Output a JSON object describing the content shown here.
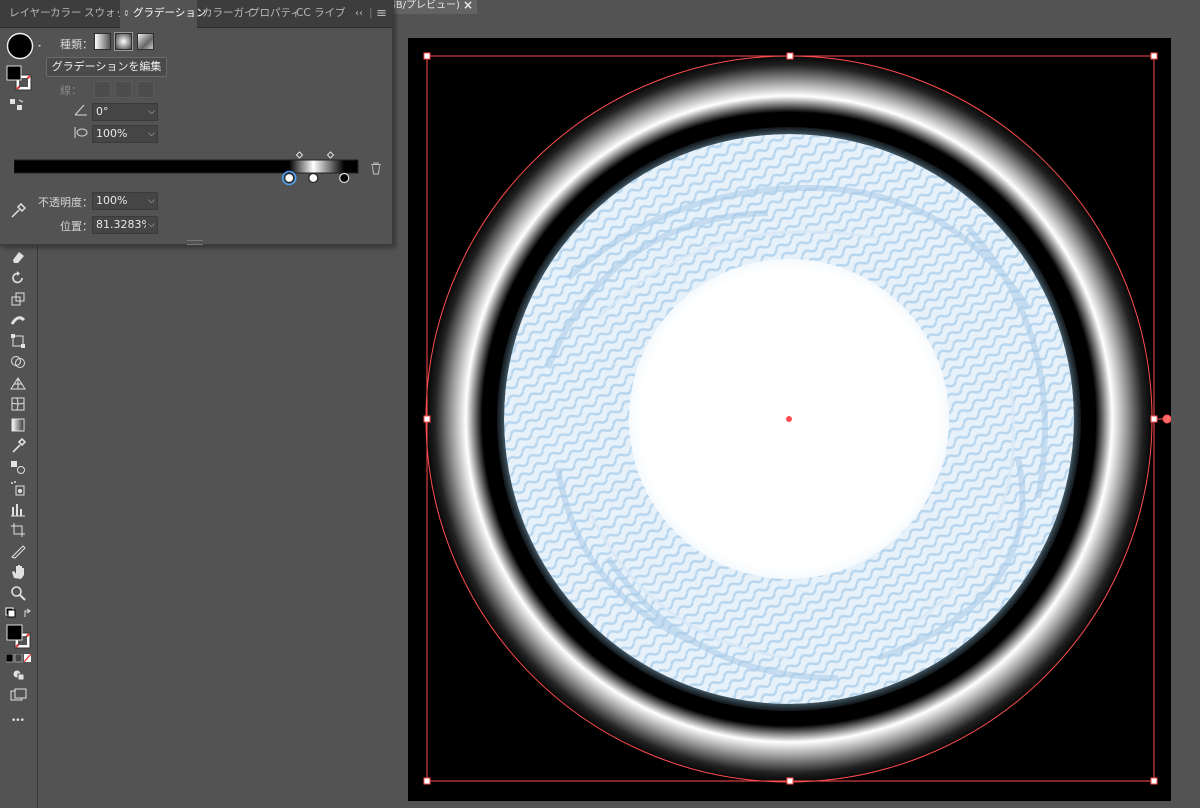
{
  "doc_tab": {
    "title": "GB/プレビュー)",
    "close": "×"
  },
  "panel": {
    "tabs": [
      {
        "label": "レイヤー",
        "active": false
      },
      {
        "label": "カラー",
        "active": false
      },
      {
        "label": "スウォッチ",
        "active": false
      },
      {
        "label": "グラデーション",
        "active": true
      },
      {
        "label": "カラーガイ",
        "active": false
      },
      {
        "label": "プロパティ",
        "active": false
      },
      {
        "label": "CC ライブ",
        "active": false
      }
    ],
    "collapse_glyph": "‹‹",
    "menu_glyph": "≡",
    "type_label": "種類：",
    "edit_button": "グラデーションを編集",
    "stroke_label": "線：",
    "angle_value": "0°",
    "aspect_value": "100%",
    "opacity_label": "不透明度：",
    "opacity_value": "100%",
    "location_label": "位置：",
    "location_value": "81.3283%",
    "gradient_stops": [
      {
        "location": 0.8,
        "color": "#ffffff",
        "selected": true
      },
      {
        "location": 0.87,
        "color": "#ffffff",
        "selected": false
      },
      {
        "location": 0.96,
        "color": "#000000",
        "selected": false
      }
    ],
    "midpoints": [
      0.83,
      0.92
    ]
  },
  "toolbar": {
    "more_glyph": "•••",
    "tools": [
      "eraser-icon",
      "rotate-icon",
      "scale-icon",
      "width-icon",
      "free-transform-icon",
      "shape-builder-icon",
      "perspective-grid-icon",
      "mesh-icon",
      "gradient-icon",
      "eyedropper-icon",
      "blend-icon",
      "symbol-sprayer-icon",
      "graph-icon",
      "artboard-icon",
      "slice-icon",
      "hand-icon",
      "zoom-icon"
    ]
  },
  "colors": {
    "bounding_box": "#ff4d4d",
    "artboard": "#000000",
    "ui_bg": "#535353"
  }
}
